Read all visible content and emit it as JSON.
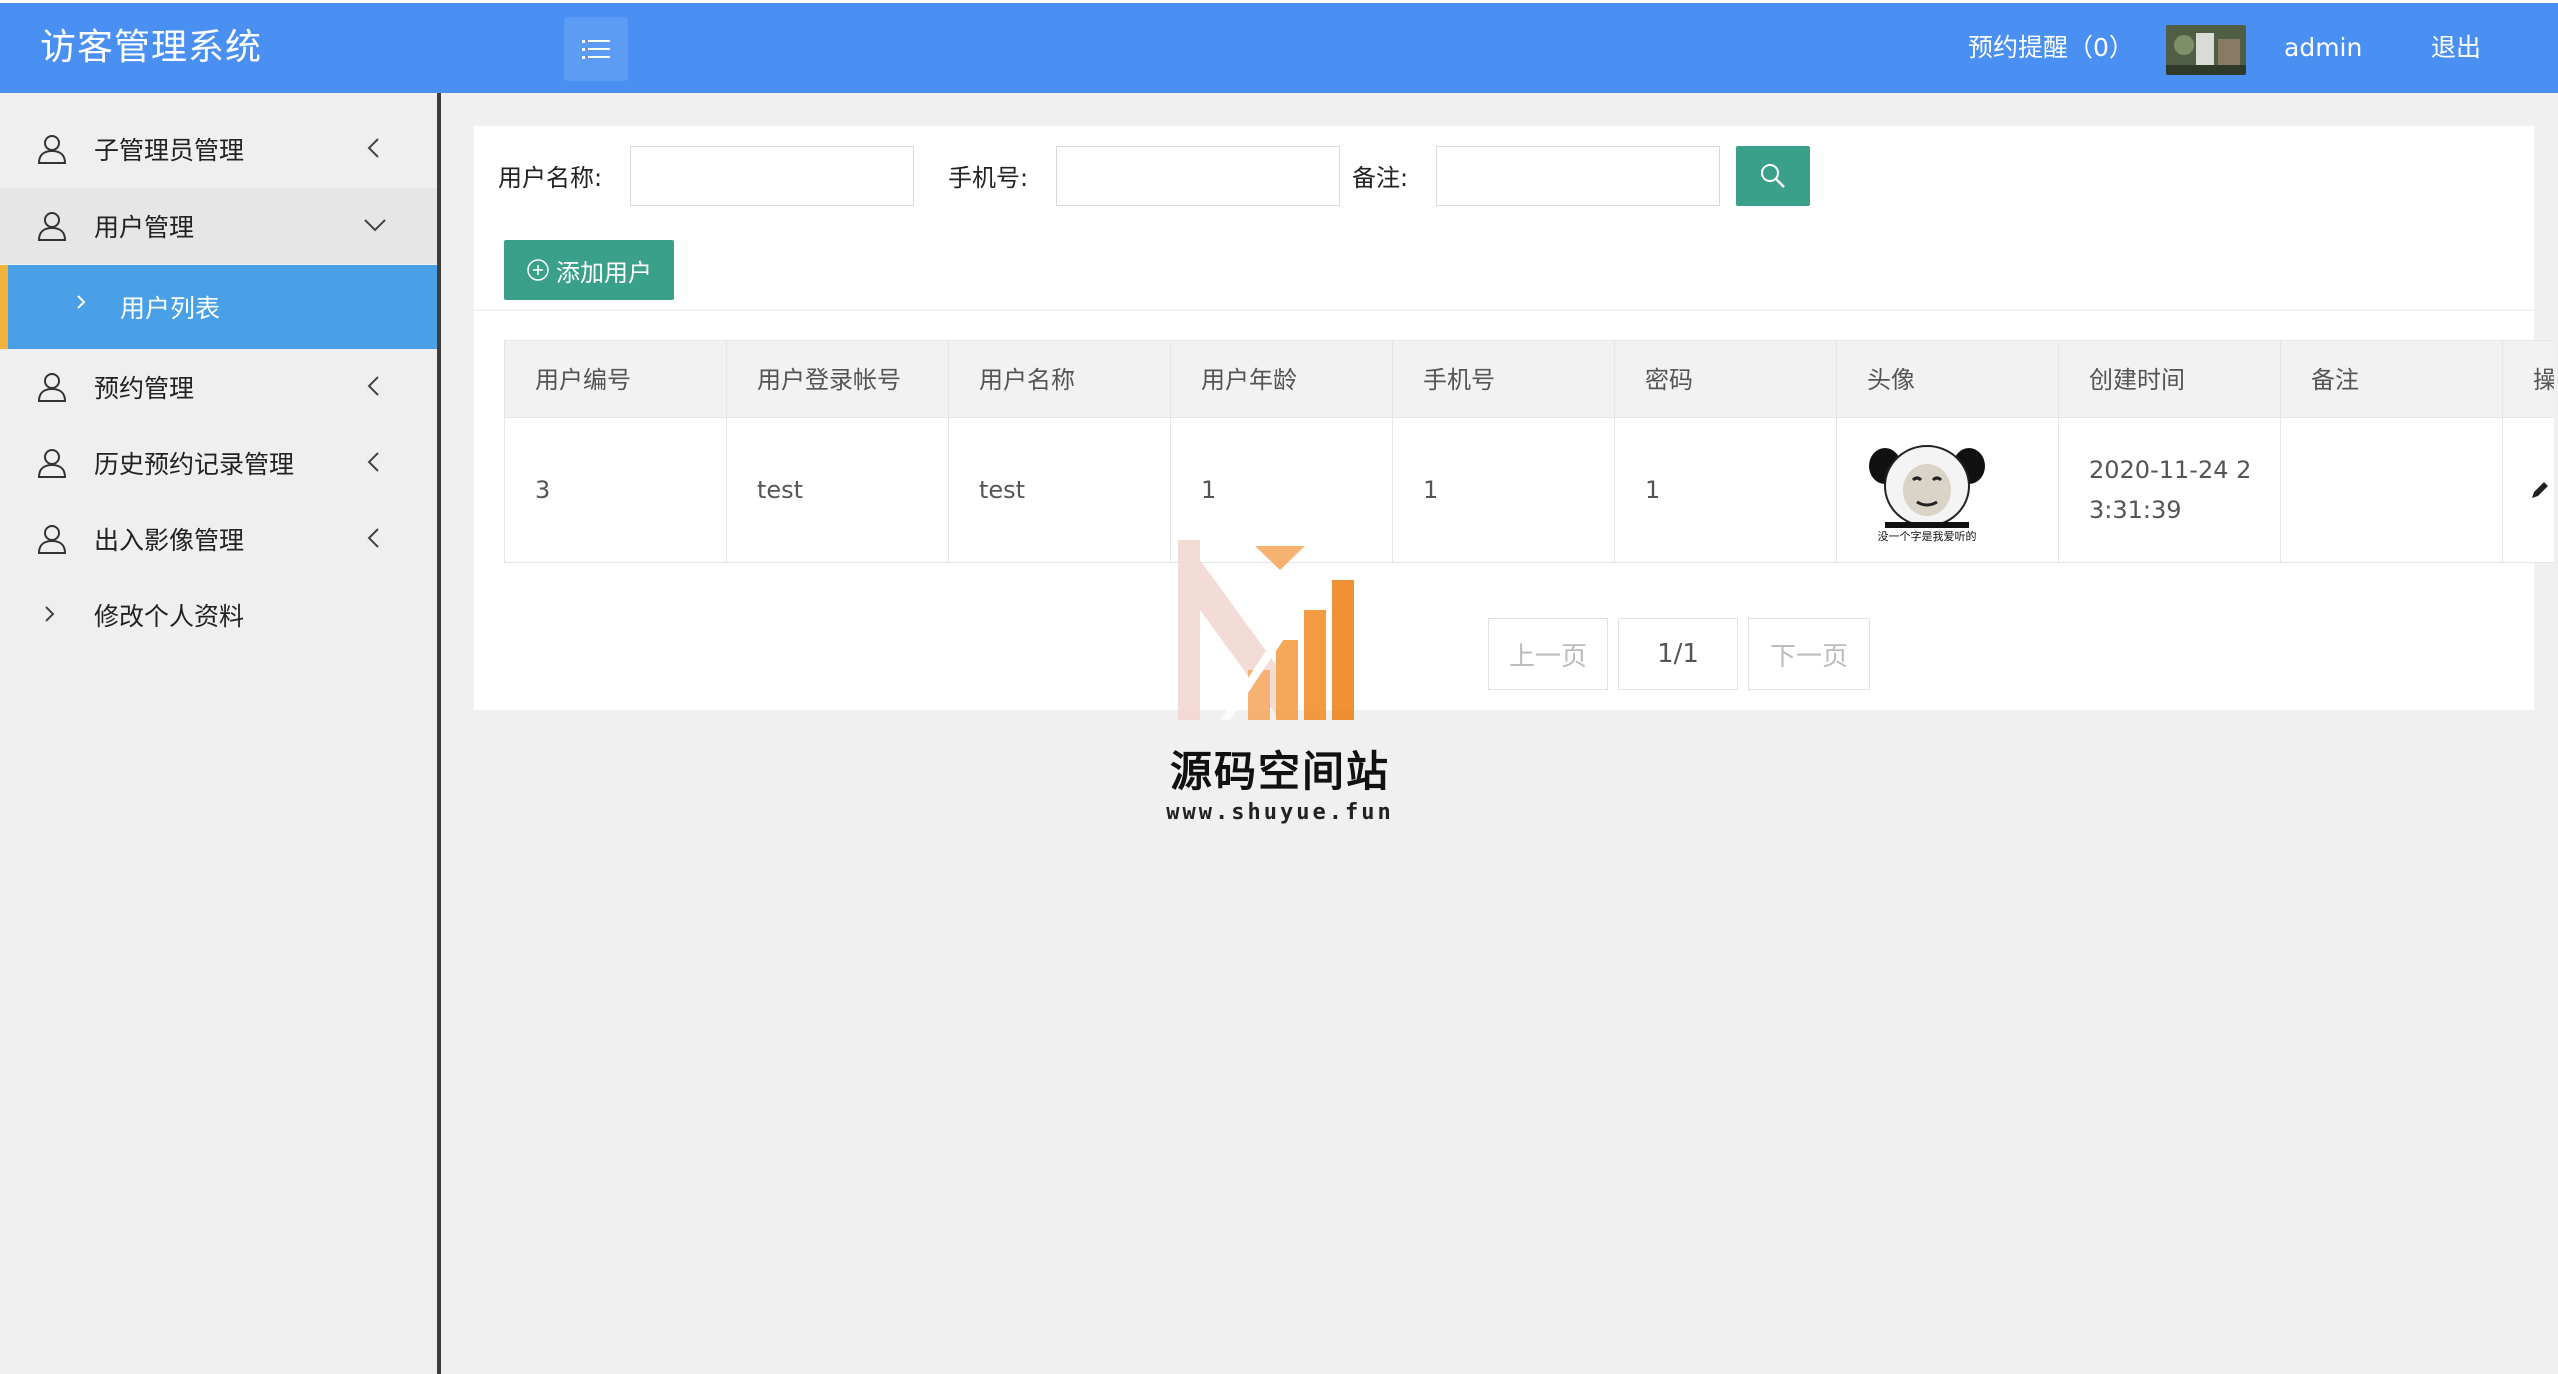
{
  "app": {
    "title": "访客管理系统"
  },
  "header": {
    "reminder_label": "预约提醒（0）",
    "user_name": "admin",
    "logout_label": "退出",
    "menu_icon": "list-icon"
  },
  "sidebar": {
    "items": [
      {
        "label": "子管理员管理",
        "icon": "user-icon",
        "state": "collapsed"
      },
      {
        "label": "用户管理",
        "icon": "user-icon",
        "state": "expanded"
      },
      {
        "label": "用户列表",
        "icon": "chevron-right-icon",
        "state": "active"
      },
      {
        "label": "预约管理",
        "icon": "user-icon",
        "state": "collapsed"
      },
      {
        "label": "历史预约记录管理",
        "icon": "user-icon",
        "state": "collapsed"
      },
      {
        "label": "出入影像管理",
        "icon": "user-icon",
        "state": "collapsed"
      },
      {
        "label": "修改个人资料",
        "icon": "chevron-right-icon",
        "state": "link"
      }
    ],
    "active_color": "#4aa0e6",
    "accent_color": "#f2b33d"
  },
  "filters": {
    "username_label": "用户名称:",
    "username_value": "",
    "phone_label": "手机号:",
    "phone_value": "",
    "remark_label": "备注:",
    "remark_value": "",
    "search_icon": "search-icon"
  },
  "toolbar": {
    "add_label": "添加用户",
    "add_icon": "plus-circle-icon",
    "button_color": "#3aa08a"
  },
  "table": {
    "columns": [
      "用户编号",
      "用户登录帐号",
      "用户名称",
      "用户年龄",
      "手机号",
      "密码",
      "头像",
      "创建时间",
      "备注",
      "操"
    ],
    "rows": [
      {
        "id": "3",
        "login": "test",
        "name": "test",
        "age": "1",
        "phone": "1",
        "password": "1",
        "avatar_caption": "没一个字是我爱听的",
        "created_line1": "2020-11-24 2",
        "created_line2": "3:31:39",
        "remark": "",
        "action_icon": "edit-icon"
      }
    ]
  },
  "pagination": {
    "prev_label": "上一页",
    "current": "1/1",
    "next_label": "下一页"
  },
  "watermark": {
    "title": "源码空间站",
    "url": "www.shuyue.fun"
  }
}
